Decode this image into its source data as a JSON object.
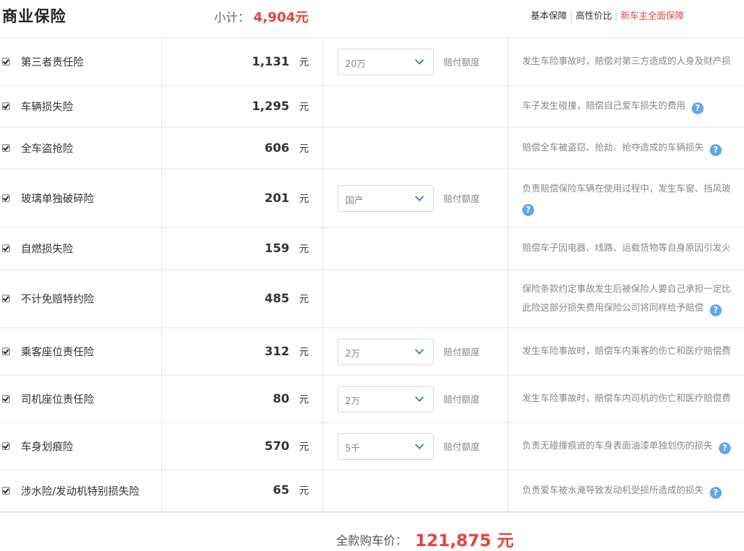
{
  "header": {
    "title": "商业保险",
    "subtotal_label": "小计：",
    "subtotal_value": "4,904元",
    "plans": [
      "基本保障",
      "高性价比",
      "新车主全面保障"
    ]
  },
  "unit": "元",
  "option_label": "赔付额度",
  "rows": [
    {
      "name": "第三者责任险",
      "price": "1,131",
      "option": "20万",
      "desc": [
        "发生车险事故时，赔偿对第三方造成的人身及财产损"
      ],
      "help": false
    },
    {
      "name": "车辆损失险",
      "price": "1,295",
      "option": null,
      "desc": [
        "车子发生碰撞，赔偿自己爱车损失的费用"
      ],
      "help": true
    },
    {
      "name": "全车盗抢险",
      "price": "606",
      "option": null,
      "desc": [
        "赔偿全车被盗窃、抢劫、抢夺造成的车辆损失"
      ],
      "help": true
    },
    {
      "name": "玻璃单独破碎险",
      "price": "201",
      "option": "国产",
      "desc": [
        "负责赔偿保险车辆在使用过程中，发生车窗、挡风玻"
      ],
      "help": true,
      "help_newline": true
    },
    {
      "name": "自燃损失险",
      "price": "159",
      "option": null,
      "desc": [
        "赔偿车子因电器、线路、运载货物等自身原因引发火"
      ],
      "help": false
    },
    {
      "name": "不计免赔特约险",
      "price": "485",
      "option": null,
      "desc": [
        "保险条款约定事故发生后被保险人要自己承担一定比",
        "此险这部分损失费用保险公司将同样给予赔偿"
      ],
      "help": true
    },
    {
      "name": "乘客座位责任险",
      "price": "312",
      "option": "2万",
      "desc": [
        "发生车险事故时，赔偿车内乘客的伤亡和医疗赔偿费"
      ],
      "help": false
    },
    {
      "name": "司机座位责任险",
      "price": "80",
      "option": "2万",
      "desc": [
        "发生车险事故时，赔偿车内司机的伤亡和医疗赔偿费"
      ],
      "help": false
    },
    {
      "name": "车身划痕险",
      "price": "570",
      "option": "5千",
      "desc": [
        "负责无碰撞痕迹的车身表面油漆单独划伤的损失"
      ],
      "help": true
    },
    {
      "name": "涉水险/发动机特别损失险",
      "price": "65",
      "option": null,
      "desc": [
        "负责爱车被水淹导致发动机受损所造成的损失"
      ],
      "help": true
    }
  ],
  "footer": {
    "label": "全款购车价：",
    "value": "121,875 元"
  },
  "icons": {
    "checkbox": "checkbox-checked-icon",
    "help": "question-circle-icon",
    "dropdown": "chevron-down-icon"
  },
  "colors": {
    "accent_red": "#e64340",
    "help_blue": "#62a6ea",
    "chevron_blue": "#3b82c4"
  }
}
